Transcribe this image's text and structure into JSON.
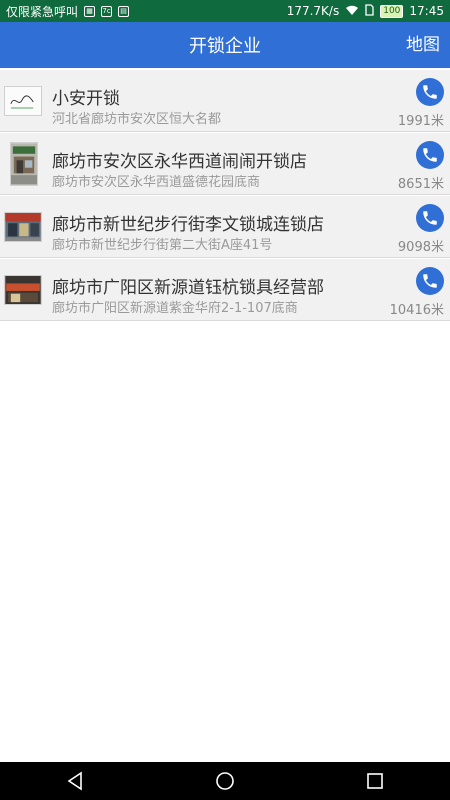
{
  "status_bar": {
    "carrier": "仅限紧急呼叫",
    "speed": "177.7K/s",
    "battery": "100",
    "time": "17:45",
    "icons": [
      "app-icon",
      "app-icon",
      "app-icon",
      "wifi-icon",
      "sim-icon",
      "battery-icon"
    ]
  },
  "header": {
    "title": "开锁企业",
    "map_label": "地图",
    "color": "#2f6fd6"
  },
  "list": [
    {
      "name": "小安开锁",
      "address": "河北省廊坊市安次区恒大名都",
      "distance": "1991米"
    },
    {
      "name": "廊坊市安次区永华西道闹闹开锁店",
      "address": "廊坊市安次区永华西道盛德花园底商",
      "distance": "8651米"
    },
    {
      "name": "廊坊市新世纪步行街李文锁城连锁店",
      "address": "廊坊市新世纪步行街第二大街A座41号",
      "distance": "9098米"
    },
    {
      "name": "廊坊市广阳区新源道钰杭锁具经营部",
      "address": "廊坊市广阳区新源道紫金华府2-1-107底商",
      "distance": "10416米"
    }
  ],
  "nav_bar": {
    "buttons": [
      "back-icon",
      "home-icon",
      "recents-icon"
    ]
  }
}
